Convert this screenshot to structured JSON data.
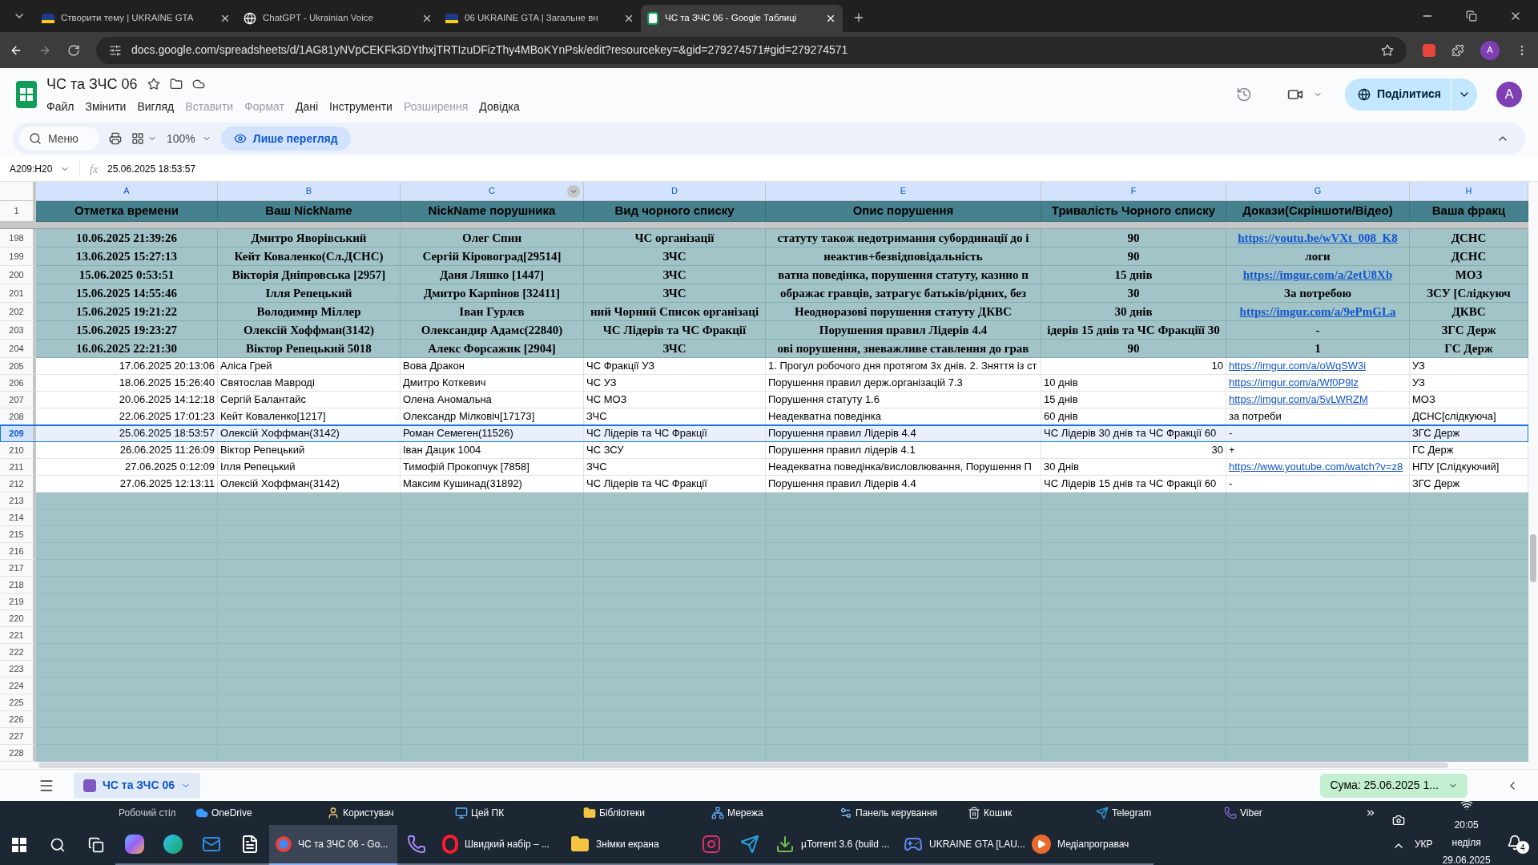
{
  "browser": {
    "tabs": [
      {
        "title": "Створити тему | UKRAINE GTA",
        "selected": false,
        "kind": "forum"
      },
      {
        "title": "ChatGPT - Ukrainian Voice",
        "selected": false,
        "kind": "chatgpt"
      },
      {
        "title": "06 UKRAINE GTA | Загальне вн",
        "selected": false,
        "kind": "forum"
      },
      {
        "title": "ЧС та ЗЧС 06 - Google Таблиці",
        "selected": true,
        "kind": "sheets"
      }
    ],
    "url": "docs.google.com/spreadsheets/d/1AG81yNVpCEKFk3DYthxjTRTIzuDFizThy4MBoKYnPsk/edit?resourcekey=&gid=279274571#gid=279274571",
    "profile": "A"
  },
  "doc": {
    "title": "ЧС та ЗЧС 06",
    "menu": [
      {
        "label": "Файл",
        "disabled": false
      },
      {
        "label": "Змінити",
        "disabled": false
      },
      {
        "label": "Вигляд",
        "disabled": false
      },
      {
        "label": "Вставити",
        "disabled": true
      },
      {
        "label": "Формат",
        "disabled": true
      },
      {
        "label": "Дані",
        "disabled": false
      },
      {
        "label": "Інструменти",
        "disabled": false
      },
      {
        "label": "Розширення",
        "disabled": true
      },
      {
        "label": "Довідка",
        "disabled": false
      }
    ],
    "share": "Поділитися",
    "avatar": "A"
  },
  "toolbar": {
    "search": "Меню",
    "zoom": "100%",
    "view_mode": "Лише перегляд"
  },
  "formula_bar": {
    "fx": "fx",
    "name_box": "A209:H20",
    "value": "25.06.2025 18:53:57"
  },
  "columns": [
    {
      "label": "A",
      "selected": true
    },
    {
      "label": "B",
      "selected": true
    },
    {
      "label": "C",
      "selected": true
    },
    {
      "label": "D",
      "selected": true
    },
    {
      "label": "E",
      "selected": true
    },
    {
      "label": "F",
      "selected": true
    },
    {
      "label": "G",
      "selected": true
    },
    {
      "label": "H",
      "selected": true
    }
  ],
  "header_row": {
    "number": "1",
    "cells": [
      "Отметка времени",
      "Ваш NickName",
      "NickName порушника",
      "Вид чорного списку",
      "Опис порушення",
      "Тривалість Чорного списку",
      "Докази(Скріншоти/Відео)",
      "Ваша фракц"
    ]
  },
  "rows": [
    {
      "number": "198",
      "bold": true,
      "selected": false,
      "cells": [
        {
          "text": "10.06.2025 21:39:26",
          "kind": "number"
        },
        {
          "text": "Дмитро Яворівський",
          "kind": "text"
        },
        {
          "text": "Олег Спин",
          "kind": "text"
        },
        {
          "text": "ЧС організації",
          "kind": "text"
        },
        {
          "text": "статуту також недотримання субординації до і",
          "kind": "text"
        },
        {
          "text": "90",
          "kind": "number"
        },
        {
          "text": "https://youtu.be/wVXt_008_K8",
          "kind": "link"
        },
        {
          "text": "ДСНС",
          "kind": "text"
        }
      ]
    },
    {
      "number": "199",
      "bold": true,
      "selected": false,
      "cells": [
        {
          "text": "13.06.2025 15:27:13",
          "kind": "number"
        },
        {
          "text": "Кейт Коваленко(Сл.ДСНС)",
          "kind": "text"
        },
        {
          "text": "Сергій Кіровоград[29514]",
          "kind": "text"
        },
        {
          "text": "ЗЧС",
          "kind": "text"
        },
        {
          "text": "неактив+безвідповідальність",
          "kind": "text"
        },
        {
          "text": "90",
          "kind": "number"
        },
        {
          "text": "логи",
          "kind": "text"
        },
        {
          "text": "ДСНС",
          "kind": "text"
        }
      ]
    },
    {
      "number": "200",
      "bold": true,
      "selected": false,
      "cells": [
        {
          "text": "15.06.2025 0:53:51",
          "kind": "number"
        },
        {
          "text": "Вікторія Дніпровська [2957]",
          "kind": "text"
        },
        {
          "text": "Даня Ляшко [1447]",
          "kind": "text"
        },
        {
          "text": "ЗЧС",
          "kind": "text"
        },
        {
          "text": "ватна поведінка, порушення статуту, казино п",
          "kind": "text"
        },
        {
          "text": "15 днів",
          "kind": "text"
        },
        {
          "text": "https://imgur.com/a/2etU8Xb",
          "kind": "link"
        },
        {
          "text": "МОЗ",
          "kind": "text"
        }
      ]
    },
    {
      "number": "201",
      "bold": true,
      "selected": false,
      "cells": [
        {
          "text": "15.06.2025 14:55:46",
          "kind": "number"
        },
        {
          "text": "Ілля Репецький",
          "kind": "text"
        },
        {
          "text": "Дмитро Карпінов [32411]",
          "kind": "text"
        },
        {
          "text": "ЗЧС",
          "kind": "text"
        },
        {
          "text": "ображає гравців, затрагує батьків/рідних, без",
          "kind": "text"
        },
        {
          "text": "30",
          "kind": "number"
        },
        {
          "text": "За потребою",
          "kind": "text"
        },
        {
          "text": "ЗСУ [Слідкуюч",
          "kind": "text"
        }
      ]
    },
    {
      "number": "202",
      "bold": true,
      "selected": false,
      "cells": [
        {
          "text": "15.06.2025 19:21:22",
          "kind": "number"
        },
        {
          "text": "Володимир Міллер",
          "kind": "text"
        },
        {
          "text": "Іван Гурлєв",
          "kind": "text"
        },
        {
          "text": "ний Чорний Список організаці",
          "kind": "text"
        },
        {
          "text": "Неодноразові порушення статуту ДКВС",
          "kind": "text"
        },
        {
          "text": "30 днів",
          "kind": "text"
        },
        {
          "text": "https://imgur.com/a/9ePmGLa",
          "kind": "link"
        },
        {
          "text": "ДКВС",
          "kind": "text"
        }
      ]
    },
    {
      "number": "203",
      "bold": true,
      "selected": false,
      "cells": [
        {
          "text": "15.06.2025 19:23:27",
          "kind": "number"
        },
        {
          "text": "Олексій Хоффман(3142)",
          "kind": "text"
        },
        {
          "text": "Олександир Адамс(22840)",
          "kind": "text"
        },
        {
          "text": "ЧС Лідерів та ЧС Фракції",
          "kind": "text"
        },
        {
          "text": "Порушення правил Лідерів 4.4",
          "kind": "text"
        },
        {
          "text": "ідерів 15 днів та ЧС Фракціїї 30",
          "kind": "text"
        },
        {
          "text": "-",
          "kind": "text"
        },
        {
          "text": "ЗГС Держ",
          "kind": "text"
        }
      ]
    },
    {
      "number": "204",
      "bold": true,
      "selected": false,
      "cells": [
        {
          "text": "16.06.2025 22:21:30",
          "kind": "number"
        },
        {
          "text": "Віктор Репецький 5018",
          "kind": "text"
        },
        {
          "text": "Алекс Форсажик [2904]",
          "kind": "text"
        },
        {
          "text": "ЗЧС",
          "kind": "text"
        },
        {
          "text": "ові порушення, зневажливе ставлення до грав",
          "kind": "text"
        },
        {
          "text": "90",
          "kind": "number"
        },
        {
          "text": "1",
          "kind": "number"
        },
        {
          "text": "ГС Держ",
          "kind": "text"
        }
      ]
    },
    {
      "number": "205",
      "bold": false,
      "selected": false,
      "cells": [
        {
          "text": "17.06.2025 20:13:06",
          "kind": "number"
        },
        {
          "text": "Аліса Грей",
          "kind": "text"
        },
        {
          "text": "Вова Дракон",
          "kind": "text"
        },
        {
          "text": "ЧС Фракції УЗ",
          "kind": "text"
        },
        {
          "text": "1. Прогул робочого дня протягом 3х днів. 2. Зняття із ст",
          "kind": "text"
        },
        {
          "text": "10",
          "kind": "number"
        },
        {
          "text": "https://imgur.com/a/oWqSW3i",
          "kind": "link"
        },
        {
          "text": "УЗ",
          "kind": "text"
        }
      ]
    },
    {
      "number": "206",
      "bold": false,
      "selected": false,
      "cells": [
        {
          "text": "18.06.2025 15:26:40",
          "kind": "number"
        },
        {
          "text": "Святослав Мавроді",
          "kind": "text"
        },
        {
          "text": "Дмитро Коткевич",
          "kind": "text"
        },
        {
          "text": "ЧС УЗ",
          "kind": "text"
        },
        {
          "text": "Порушення правил держ.організацій 7.3",
          "kind": "text"
        },
        {
          "text": "10 днів",
          "kind": "text"
        },
        {
          "text": "https://imgur.com/a/Wf0P9lz",
          "kind": "link"
        },
        {
          "text": "УЗ",
          "kind": "text"
        }
      ]
    },
    {
      "number": "207",
      "bold": false,
      "selected": false,
      "cells": [
        {
          "text": "20.06.2025 14:12:18",
          "kind": "number"
        },
        {
          "text": "Сергій Балантайс",
          "kind": "text"
        },
        {
          "text": "Олена Аномальна",
          "kind": "text"
        },
        {
          "text": "ЧС МОЗ",
          "kind": "text"
        },
        {
          "text": "Порушення статуту 1.6",
          "kind": "text"
        },
        {
          "text": "15 днів",
          "kind": "text"
        },
        {
          "text": "https://imgur.com/a/5vLWRZM",
          "kind": "link"
        },
        {
          "text": "МОЗ",
          "kind": "text"
        }
      ]
    },
    {
      "number": "208",
      "bold": false,
      "selected": false,
      "cells": [
        {
          "text": "22.06.2025 17:01:23",
          "kind": "number"
        },
        {
          "text": "Кейт Коваленко[1217]",
          "kind": "text"
        },
        {
          "text": "Олександр Мілковіч[17173]",
          "kind": "text"
        },
        {
          "text": "ЗЧС",
          "kind": "text"
        },
        {
          "text": "Неадекватна поведінка",
          "kind": "text"
        },
        {
          "text": "60 днів",
          "kind": "text"
        },
        {
          "text": "за потреби",
          "kind": "text"
        },
        {
          "text": "ДСНС[слідкуюча]",
          "kind": "text"
        }
      ]
    },
    {
      "number": "209",
      "bold": false,
      "selected": true,
      "cells": [
        {
          "text": "25.06.2025 18:53:57",
          "kind": "number"
        },
        {
          "text": "Олексій Хоффман(3142)",
          "kind": "text"
        },
        {
          "text": "Роман Семеген(11526)",
          "kind": "text"
        },
        {
          "text": "ЧС Лідерів та ЧС Фракції",
          "kind": "text"
        },
        {
          "text": "Порушення правил Лідерів 4.4",
          "kind": "text"
        },
        {
          "text": "ЧС Лідерів 30 днів та ЧС Фракції 60",
          "kind": "text"
        },
        {
          "text": "-",
          "kind": "text"
        },
        {
          "text": "ЗГС Держ",
          "kind": "text"
        }
      ]
    },
    {
      "number": "210",
      "bold": false,
      "selected": false,
      "cells": [
        {
          "text": "26.06.2025 11:26:09",
          "kind": "number"
        },
        {
          "text": "Віктор Репецький",
          "kind": "text"
        },
        {
          "text": "Іван Дацик 1004",
          "kind": "text"
        },
        {
          "text": "ЧС ЗСУ",
          "kind": "text"
        },
        {
          "text": "Порушення правил лідерів 4.1",
          "kind": "text"
        },
        {
          "text": "30",
          "kind": "number"
        },
        {
          "text": "+",
          "kind": "text"
        },
        {
          "text": "ГС Держ",
          "kind": "text"
        }
      ]
    },
    {
      "number": "211",
      "bold": false,
      "selected": false,
      "cells": [
        {
          "text": "27.06.2025 0:12:09",
          "kind": "number"
        },
        {
          "text": "Ілля Репецький",
          "kind": "text"
        },
        {
          "text": "Тимофій Прокопчук [7858]",
          "kind": "text"
        },
        {
          "text": "ЗЧС",
          "kind": "text"
        },
        {
          "text": "Неадекватна поведінка/висловлювання, Порушення П",
          "kind": "text"
        },
        {
          "text": "30 Днів",
          "kind": "text"
        },
        {
          "text": "https://www.youtube.com/watch?v=z8",
          "kind": "link"
        },
        {
          "text": "НПУ [Слідкуючий]",
          "kind": "text"
        }
      ]
    },
    {
      "number": "212",
      "bold": false,
      "selected": false,
      "cells": [
        {
          "text": "27.06.2025 12:13:11",
          "kind": "number"
        },
        {
          "text": "Олексій Хоффман(3142)",
          "kind": "text"
        },
        {
          "text": "Максим Кушинад(31892)",
          "kind": "text"
        },
        {
          "text": "ЧС Лідерів та ЧС Фракції",
          "kind": "text"
        },
        {
          "text": "Порушення правил Лідерів 4.4",
          "kind": "text"
        },
        {
          "text": "ЧС Лідерів 15 днів та ЧС Фракції 60",
          "kind": "text"
        },
        {
          "text": "-",
          "kind": "text"
        },
        {
          "text": "ЗГС Держ",
          "kind": "text"
        }
      ]
    }
  ],
  "empty_rows": [
    "213",
    "214",
    "215",
    "216",
    "217",
    "218",
    "219",
    "220",
    "221",
    "222",
    "223",
    "224",
    "225",
    "226",
    "227",
    "228"
  ],
  "sheet_bar": {
    "tab": "ЧС та ЗЧС 06",
    "sum": "Сума: 25.06.2025 1..."
  },
  "taskbar": {
    "toolbar_label": "Робочий стіл",
    "quick_links": [
      {
        "label": "OneDrive",
        "kind": "cloud"
      },
      {
        "label": "Користувач",
        "kind": "user"
      },
      {
        "label": "Цей ПК",
        "kind": "pc"
      },
      {
        "label": "Бібліотеки",
        "kind": "folder"
      },
      {
        "label": "Мережа",
        "kind": "network"
      },
      {
        "label": "Панель керування",
        "kind": "panel"
      },
      {
        "label": "Кошик",
        "kind": "bin"
      },
      {
        "label": "Telegram",
        "kind": "telegram"
      },
      {
        "label": "Viber",
        "kind": "viber"
      }
    ],
    "apps": [
      {
        "kind": "copilot",
        "selected": false
      },
      {
        "kind": "edge",
        "selected": false
      },
      {
        "kind": "outlook",
        "selected": false
      },
      {
        "kind": "file",
        "selected": false
      },
      {
        "label": "ЧС та ЗЧС 06 - Go...",
        "kind": "chrome",
        "selected": true
      },
      {
        "kind": "viber",
        "selected": false
      },
      {
        "label": "Швидкий набір – ...",
        "kind": "opera",
        "selected": false
      },
      {
        "label": "Знімки екрана",
        "kind": "folder",
        "selected": false
      },
      {
        "kind": "instagram",
        "selected": false
      },
      {
        "kind": "telegram",
        "selected": false
      },
      {
        "label": "µTorrent 3.6  (build ...",
        "kind": "torrent",
        "selected": false
      },
      {
        "label": "UKRAINE GTA [LAU...",
        "kind": "game",
        "selected": false
      },
      {
        "label": "Медіапрогравач",
        "kind": "media",
        "selected": false
      }
    ],
    "language": "УКР",
    "time": "20:05",
    "day": "неділя",
    "date": "29.06.2025",
    "notifications": "4"
  }
}
